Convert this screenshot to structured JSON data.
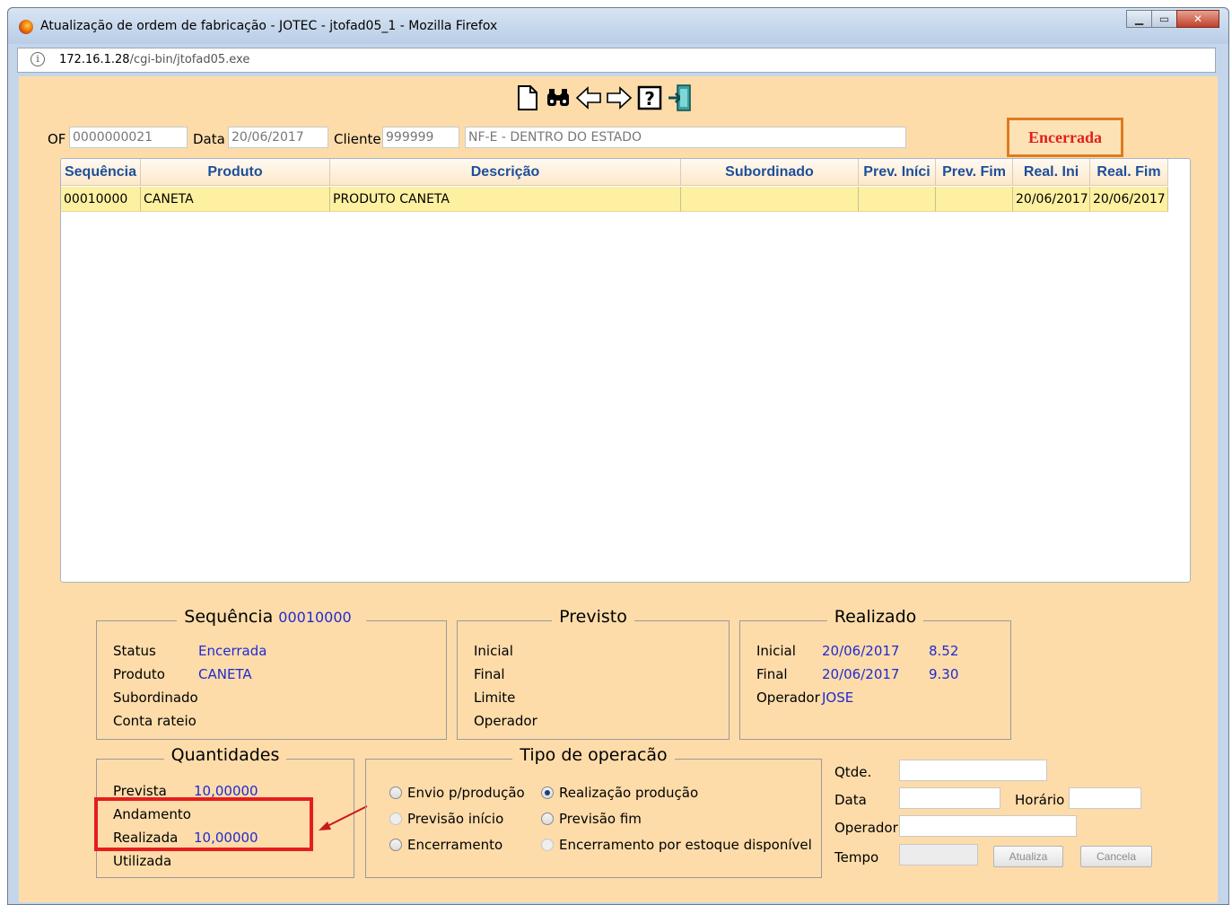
{
  "window": {
    "title": "Atualização de ordem de fabricação - JOTEC - jtofad05_1 - Mozilla Firefox",
    "url_host": "172.16.1.28",
    "url_path": "/cgi-bin/jtofad05.exe",
    "buttons": [
      "_",
      "□",
      "X"
    ]
  },
  "toolbar": {
    "icons": [
      "new-document-icon",
      "binoculars-icon",
      "arrow-left-icon",
      "arrow-right-icon",
      "help-icon",
      "exit-icon"
    ]
  },
  "header": {
    "of_label": "OF",
    "of_value": "0000000021",
    "data_label": "Data",
    "data_value": "20/06/2017",
    "cliente_label": "Cliente",
    "cliente_value": "999999",
    "cliente_name": "NF-E - DENTRO DO ESTADO",
    "status": "Encerrada"
  },
  "grid": {
    "columns": [
      "Sequência",
      "Produto",
      "Descrição",
      "Subordinado",
      "Prev. Iníci",
      "Prev. Fim",
      "Real. Ini",
      "Real. Fim"
    ],
    "rows": [
      [
        "00010000",
        "CANETA",
        "PRODUTO CANETA",
        "",
        "",
        "",
        "20/06/2017",
        "20/06/2017"
      ]
    ]
  },
  "sequencia": {
    "legend": "Sequência",
    "legend_value": "00010000",
    "status_label": "Status",
    "status_value": "Encerrada",
    "produto_label": "Produto",
    "produto_value": "CANETA",
    "subordinado_label": "Subordinado",
    "conta_label": "Conta rateio"
  },
  "previsto": {
    "legend": "Previsto",
    "inicial_label": "Inicial",
    "final_label": "Final",
    "limite_label": "Limite",
    "operador_label": "Operador"
  },
  "realizado": {
    "legend": "Realizado",
    "inicial_label": "Inicial",
    "inicial_date": "20/06/2017",
    "inicial_time": "8.52",
    "final_label": "Final",
    "final_date": "20/06/2017",
    "final_time": "9.30",
    "operador_label": "Operador",
    "operador_value": "JOSE"
  },
  "quantidades": {
    "legend": "Quantidades",
    "prevista_label": "Prevista",
    "prevista_value": "10,00000",
    "andamento_label": "Andamento",
    "realizada_label": "Realizada",
    "realizada_value": "10,00000",
    "utilizada_label": "Utilizada"
  },
  "tipo_operacao": {
    "legend": "Tipo de operacão",
    "envio": "Envio p/produção",
    "realizacao": "Realização produção",
    "previsao_inicio": "Previsão início",
    "previsao_fim": "Previsão fim",
    "encerramento": "Encerramento",
    "encerramento_estoque": "Encerramento por estoque disponível"
  },
  "form": {
    "qtde_label": "Qtde.",
    "data_label": "Data",
    "horario_label": "Horário",
    "operador_label": "Operador",
    "tempo_label": "Tempo",
    "atualiza_label": "Atualiza",
    "cancela_label": "Cancela"
  },
  "colors": {
    "background": "#fddcaa",
    "grid_header_text": "#1f4e9a",
    "value_text": "#1f2bd1",
    "status_text": "#e0201b",
    "highlight": "#e51d1d"
  }
}
